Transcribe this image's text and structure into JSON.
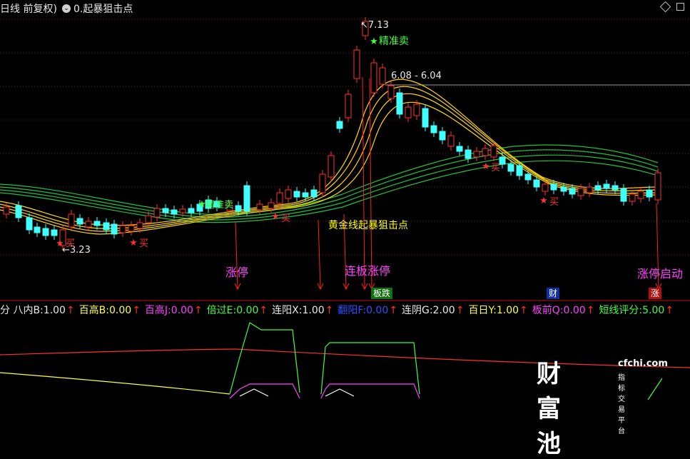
{
  "header": {
    "title_left": "日线 前复权)",
    "formula_name": "0.起暴狙击点"
  },
  "price_labels": {
    "high": "7.13",
    "low": "3.23",
    "range": "6.08 - 6.04"
  },
  "annotations": {
    "sell_signal": "精准卖",
    "sell_signal_small": "精准卖",
    "buy": "买",
    "gold_line": "黄金线起暴狙击点",
    "limit_up": "涨停",
    "consecutive": "连板涨停",
    "limit_start": "涨停启动"
  },
  "tags": {
    "board_fall": "板跌",
    "finance": "财",
    "rise": "涨"
  },
  "indicator_bar": [
    {
      "label": "分 八内B:",
      "value": "1.00",
      "color": "#e8e8e8"
    },
    {
      "label": "百高B:",
      "value": "0.00",
      "color": "#ffff40"
    },
    {
      "label": "百高J:",
      "value": "0.00",
      "color": "#ff40ff"
    },
    {
      "label": "倍过E:",
      "value": "0.00",
      "color": "#40ff40"
    },
    {
      "label": "连阳X:",
      "value": "1.00",
      "color": "#e8e8e8"
    },
    {
      "label": "翻阳F:",
      "value": "0.00",
      "color": "#3050ff"
    },
    {
      "label": "连阴G:",
      "value": "2.00",
      "color": "#e8e8e8"
    },
    {
      "label": "百日Y:",
      "value": "1.00",
      "color": "#ffff40"
    },
    {
      "label": "板前Q:",
      "value": "0.00",
      "color": "#ff40ff"
    },
    {
      "label": "短线评分:",
      "value": "5.00",
      "color": "#40ff40"
    }
  ],
  "logo": {
    "brand": "财富池",
    "url": "cfchi.com",
    "slogan": "指标交易平台"
  },
  "colors": {
    "up": "#ff3030",
    "down": "#40ffff",
    "ma_yellow": "#ffd700",
    "ma_green": "#20c040",
    "annotation": "#ff40ff",
    "gold_text": "#ffff00"
  }
}
